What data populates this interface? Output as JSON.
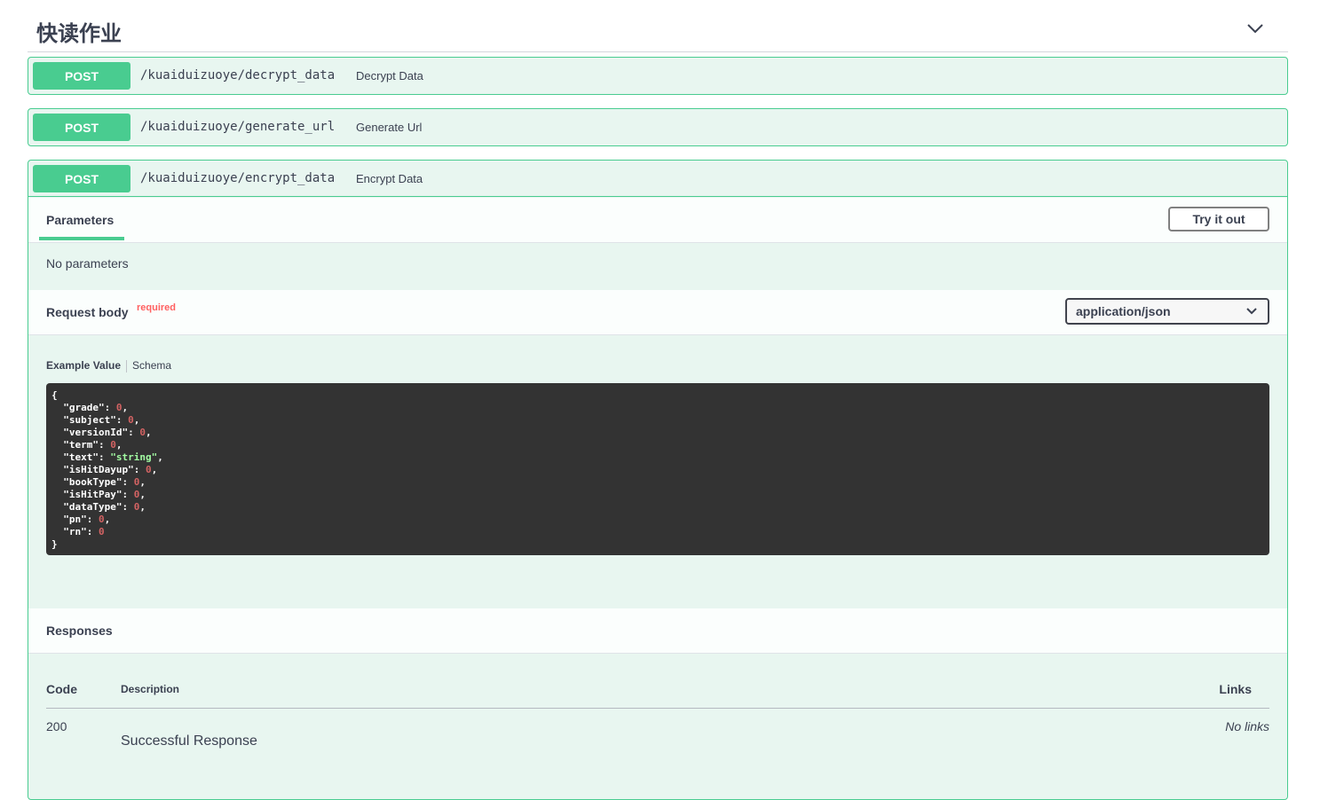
{
  "section": {
    "title": "快读作业"
  },
  "operations": [
    {
      "method": "POST",
      "path": "/kuaiduizuoye/decrypt_data",
      "summary": "Decrypt Data"
    },
    {
      "method": "POST",
      "path": "/kuaiduizuoye/generate_url",
      "summary": "Generate Url"
    },
    {
      "method": "POST",
      "path": "/kuaiduizuoye/encrypt_data",
      "summary": "Encrypt Data"
    }
  ],
  "expanded": {
    "parameters_tab": "Parameters",
    "try_button": "Try it out",
    "no_parameters": "No parameters",
    "request_body_label": "Request body",
    "required_label": "required",
    "content_type": "application/json",
    "example_tab": "Example Value",
    "schema_tab": "Schema",
    "example_json": [
      {
        "key": "grade",
        "value": "0",
        "type": "number"
      },
      {
        "key": "subject",
        "value": "0",
        "type": "number"
      },
      {
        "key": "versionId",
        "value": "0",
        "type": "number"
      },
      {
        "key": "term",
        "value": "0",
        "type": "number"
      },
      {
        "key": "text",
        "value": "\"string\"",
        "type": "string"
      },
      {
        "key": "isHitDayup",
        "value": "0",
        "type": "number"
      },
      {
        "key": "bookType",
        "value": "0",
        "type": "number"
      },
      {
        "key": "isHitPay",
        "value": "0",
        "type": "number"
      },
      {
        "key": "dataType",
        "value": "0",
        "type": "number"
      },
      {
        "key": "pn",
        "value": "0",
        "type": "number"
      },
      {
        "key": "rn",
        "value": "0",
        "type": "number"
      }
    ],
    "responses_label": "Responses",
    "columns": {
      "code": "Code",
      "description": "Description",
      "links": "Links"
    },
    "responses": [
      {
        "code": "200",
        "description": "Successful Response",
        "links": "No links"
      }
    ]
  },
  "colors": {
    "post": "#49cc90",
    "post_bg": "#e8f6f0",
    "code_bg": "#333333",
    "required": "#ff6060"
  },
  "icons": {
    "collapse": "chevron-down-icon",
    "select": "chevron-down-icon"
  }
}
